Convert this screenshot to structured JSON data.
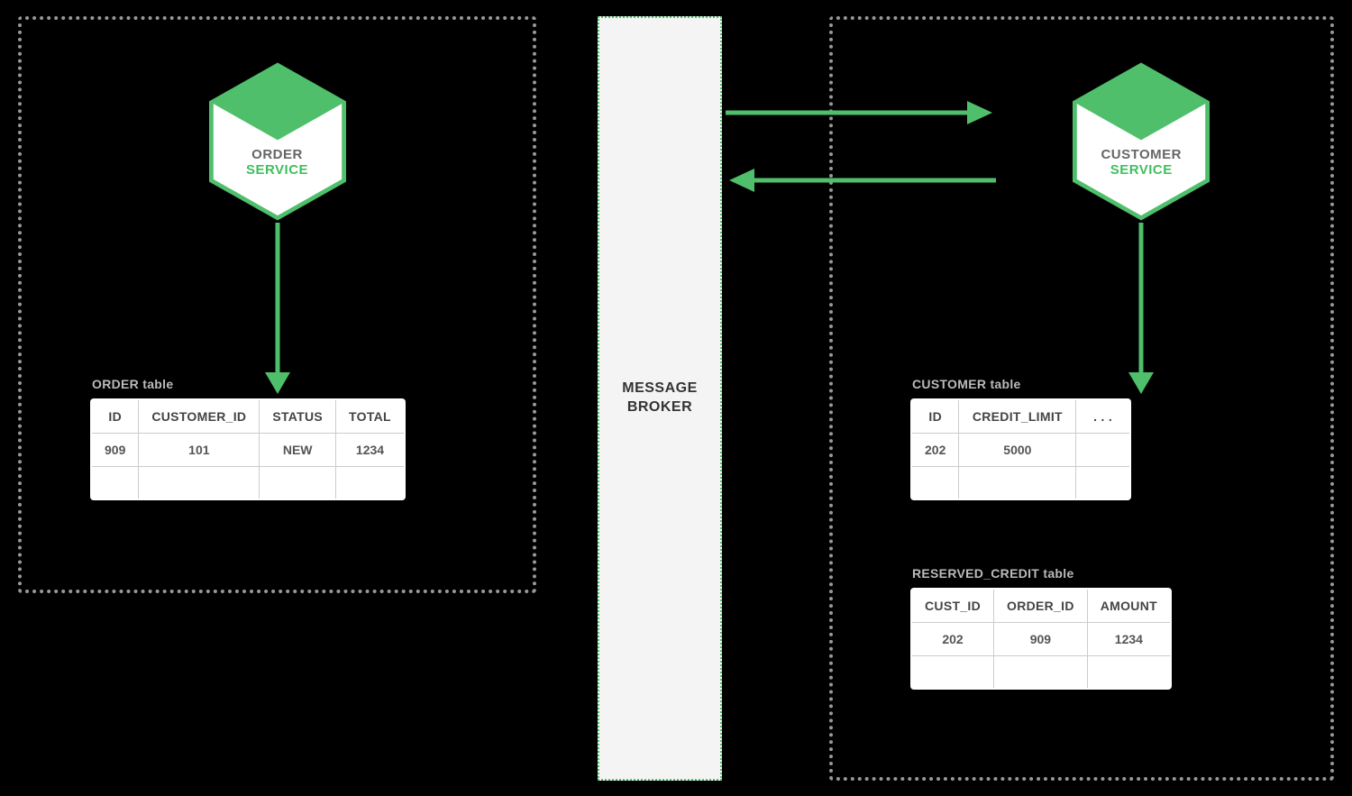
{
  "colors": {
    "green": "#4fbf6b",
    "greenDark": "#3fbf5f"
  },
  "services": {
    "order": {
      "line1": "ORDER",
      "line2": "SERVICE"
    },
    "customer": {
      "line1": "CUSTOMER",
      "line2": "SERVICE"
    }
  },
  "broker": {
    "line1": "MESSAGE",
    "line2": "BROKER"
  },
  "tables": {
    "order": {
      "caption": "ORDER table",
      "headers": [
        "ID",
        "CUSTOMER_ID",
        "STATUS",
        "TOTAL"
      ],
      "rows": [
        [
          "909",
          "101",
          "NEW",
          "1234"
        ],
        [
          "",
          "",
          "",
          ""
        ]
      ]
    },
    "customer": {
      "caption": "CUSTOMER table",
      "headers": [
        "ID",
        "CREDIT_LIMIT",
        ". . ."
      ],
      "rows": [
        [
          "202",
          "5000",
          ""
        ],
        [
          "",
          "",
          ""
        ]
      ]
    },
    "reserved": {
      "caption": "RESERVED_CREDIT table",
      "headers": [
        "CUST_ID",
        "ORDER_ID",
        "AMOUNT"
      ],
      "rows": [
        [
          "202",
          "909",
          "1234"
        ],
        [
          "",
          "",
          ""
        ]
      ]
    }
  }
}
